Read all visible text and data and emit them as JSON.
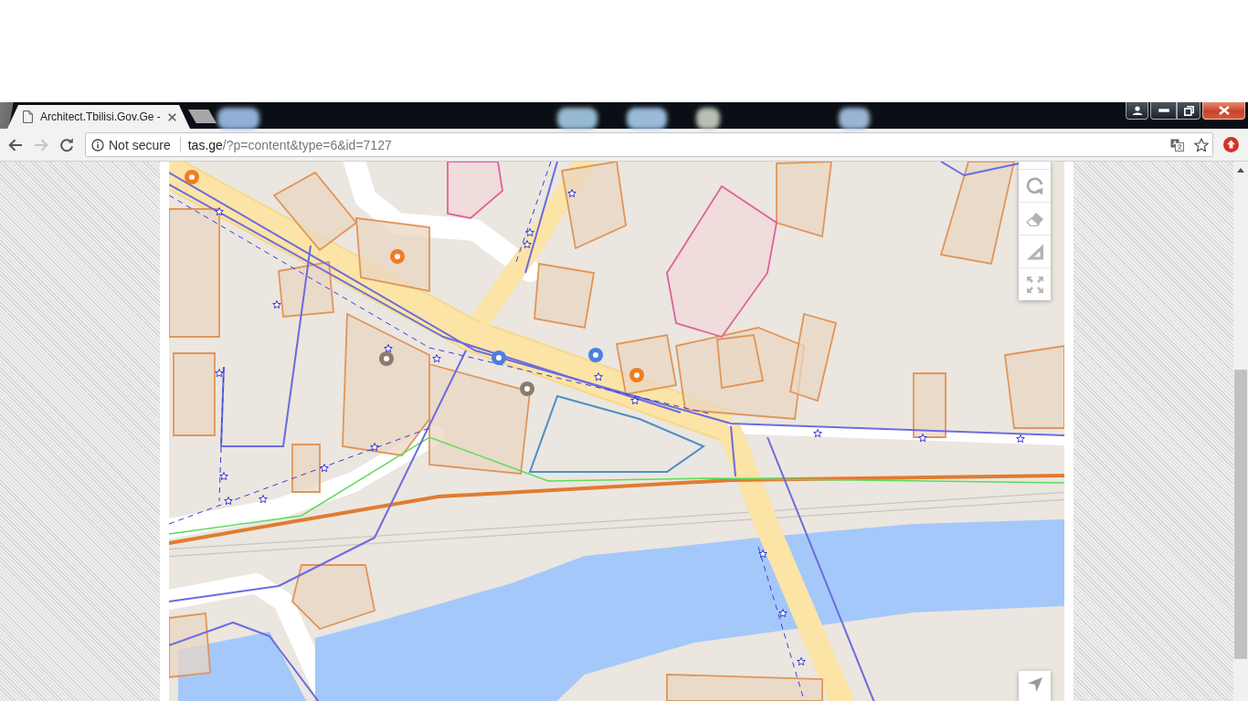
{
  "tabs": [
    {
      "title": "Architect.Tbilisi.Gov.Ge -",
      "selected": true
    }
  ],
  "toolbar": {
    "back_disabled": false,
    "forward_disabled": true
  },
  "address_bar": {
    "security": "Not secure",
    "url_host": "tas.ge",
    "url_path": "/?p=content&type=6&id=7127",
    "bookmarked": false
  }
}
